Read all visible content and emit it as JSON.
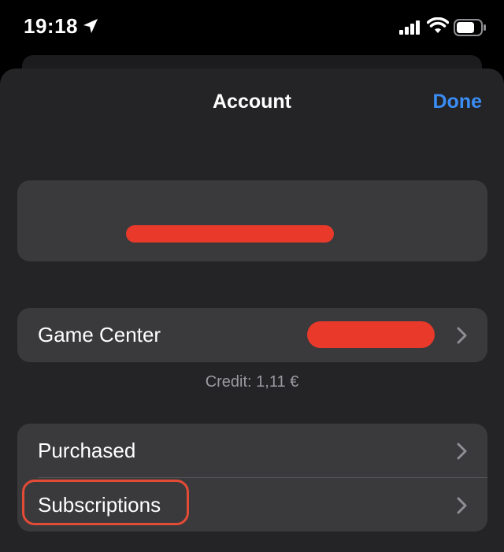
{
  "status_bar": {
    "time": "19:18",
    "icons": [
      "location-arrow-icon",
      "cellular-signal-icon",
      "wifi-icon",
      "battery-icon"
    ]
  },
  "sheet": {
    "title": "Account",
    "done_label": "Done"
  },
  "rows": {
    "game_center_label": "Game Center",
    "credit_text": "Credit: 1,11 €",
    "purchased_label": "Purchased",
    "subscriptions_label": "Subscriptions"
  },
  "colors": {
    "accent": "#3a8df5",
    "redaction": "#e8392b",
    "sheet_bg": "#242426",
    "cell_bg": "#3a3a3c",
    "annotation": "#e44b36"
  }
}
